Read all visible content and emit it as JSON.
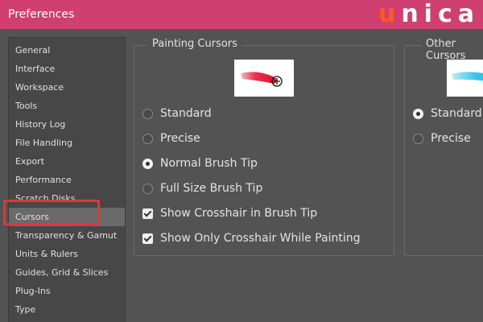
{
  "window": {
    "title": "Preferences"
  },
  "logo": {
    "text": "unica",
    "accent_color": "#ff5a1f"
  },
  "theme": {
    "titlebar_color": "#cf3f70",
    "highlight_color": "#e0363b",
    "background": "#535353"
  },
  "sidebar": {
    "items": [
      {
        "label": "General"
      },
      {
        "label": "Interface"
      },
      {
        "label": "Workspace"
      },
      {
        "label": "Tools"
      },
      {
        "label": "History Log"
      },
      {
        "label": "File Handling"
      },
      {
        "label": "Export"
      },
      {
        "label": "Performance"
      },
      {
        "label": "Scratch Disks"
      },
      {
        "label": "Cursors",
        "selected": true
      },
      {
        "label": "Transparency & Gamut"
      },
      {
        "label": "Units & Rulers"
      },
      {
        "label": "Guides, Grid & Slices"
      },
      {
        "label": "Plug-Ins"
      },
      {
        "label": "Type"
      }
    ]
  },
  "painting_cursors": {
    "title": "Painting Cursors",
    "preview_icon": "red-brush-stroke-with-crosshair",
    "options": [
      {
        "label": "Standard",
        "type": "radio",
        "checked": false
      },
      {
        "label": "Precise",
        "type": "radio",
        "checked": false
      },
      {
        "label": "Normal Brush Tip",
        "type": "radio",
        "checked": true
      },
      {
        "label": "Full Size Brush Tip",
        "type": "radio",
        "checked": false
      },
      {
        "label": "Show Crosshair in Brush Tip",
        "type": "checkbox",
        "checked": true
      },
      {
        "label": "Show Only Crosshair While Painting",
        "type": "checkbox",
        "checked": true
      }
    ]
  },
  "other_cursors": {
    "title": "Other Cursors",
    "preview_icon": "cyan-brush-stroke",
    "options": [
      {
        "label": "Standard",
        "type": "radio",
        "checked": true
      },
      {
        "label": "Precise",
        "type": "radio",
        "checked": false
      }
    ]
  }
}
